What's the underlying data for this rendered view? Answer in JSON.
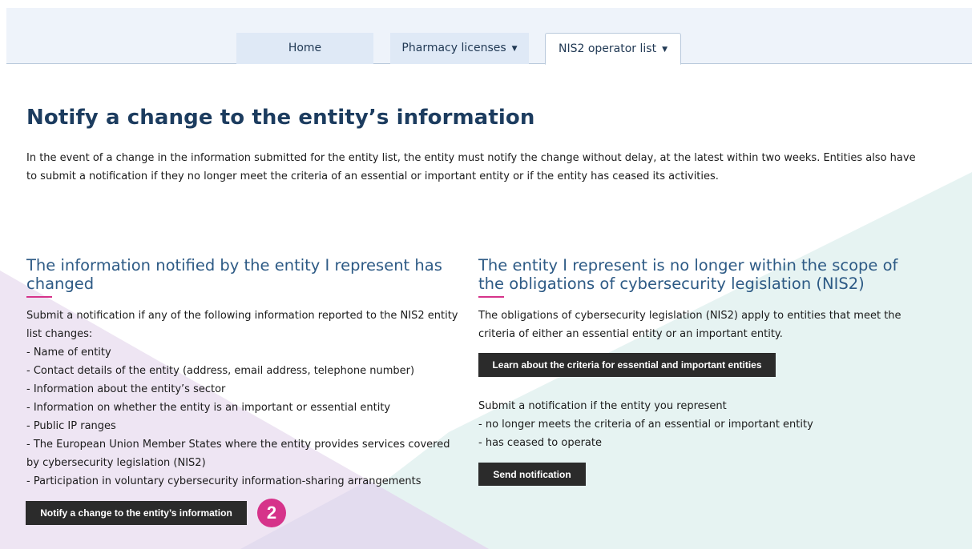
{
  "nav": {
    "tabs": [
      {
        "label": "Home",
        "has_dropdown": false,
        "active": false
      },
      {
        "label": "Pharmacy licenses",
        "has_dropdown": true,
        "active": false
      },
      {
        "label": "NIS2 operator list",
        "has_dropdown": true,
        "active": true
      }
    ],
    "dropdown_icon": "caret-down-icon"
  },
  "page": {
    "title": "Notify a change to the entity’s information",
    "intro": "In the event of a change in the information submitted for the entity list, the entity must notify the change without delay, at the latest within two weeks. Entities also have to submit a notification if they no longer meet the criteria of an essential or important entity or if the entity has ceased its activities."
  },
  "left_section": {
    "title": "The information notified by the entity I represent has changed",
    "lead": "Submit a notification if any of the following information reported to the NIS2 entity list changes:",
    "items": [
      "- Name of entity",
      "- Contact details of the entity (address, email address, telephone number)",
      "- Information about the entity’s sector",
      "- Information on whether the entity is an important or essential entity",
      "- Public IP ranges",
      "- The European Union Member States where the entity provides services covered by cybersecurity legislation (NIS2)",
      "- Participation in voluntary cybersecurity information-sharing arrangements"
    ],
    "button_label": "Notify a change to the entity’s information",
    "step_badge": "2"
  },
  "right_section": {
    "title": "The entity I represent is no longer within the scope of the obligations of cybersecurity legislation (NIS2)",
    "text": "The obligations of cybersecurity legislation (NIS2) apply to entities that meet the criteria of either an essential entity or an important entity.",
    "criteria_button_label": "Learn about the criteria for essential and important entities",
    "lead": "Submit a notification if the entity you represent",
    "items": [
      "- no longer meets the criteria of an essential or important entity",
      "- has ceased to operate"
    ],
    "send_button_label": "Send notification"
  },
  "colors": {
    "title": "#1c3c5f",
    "section_title": "#2d5a85",
    "accent": "#d6338a",
    "button_bg": "#2b2b2b",
    "nav_bg": "#eef3fa",
    "tab_bg": "#dfe9f6",
    "bg_shape_purple": "#ede4f2",
    "bg_shape_teal": "#e5f3f2"
  }
}
